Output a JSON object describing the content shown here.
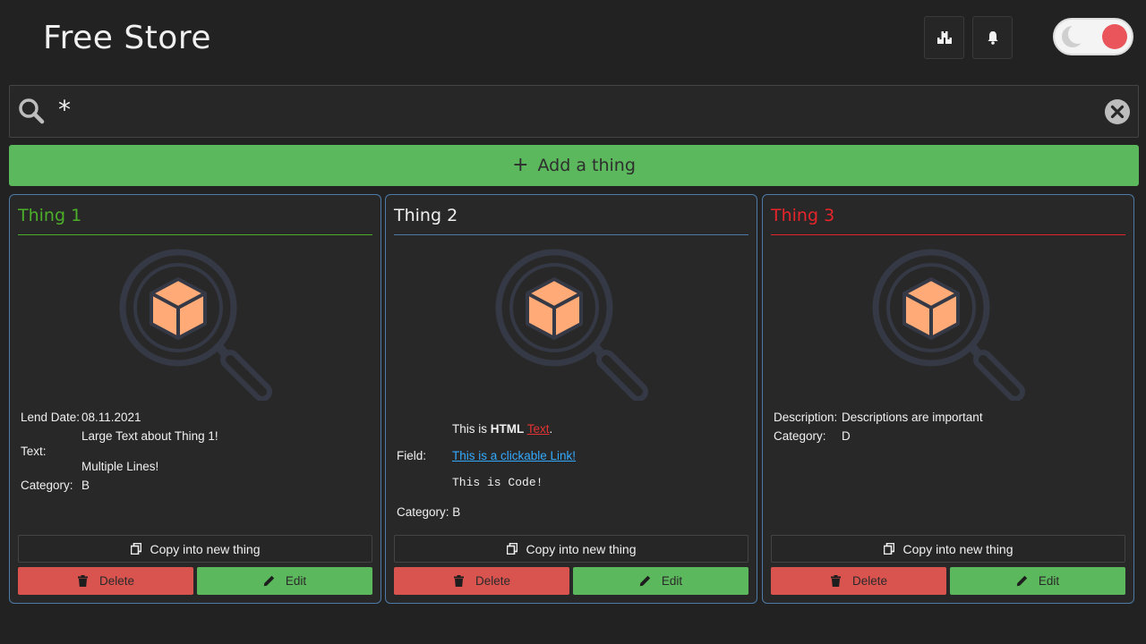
{
  "header": {
    "title": "Free Store",
    "buttons": [
      {
        "icon": "boxes-icon"
      },
      {
        "icon": "bell-icon"
      }
    ],
    "theme_toggle": {
      "icon": "moon-icon",
      "knob_color": "#e9555a"
    }
  },
  "search": {
    "value": "*",
    "placeholder": ""
  },
  "add_button": {
    "label": "Add a thing"
  },
  "colors": {
    "green": "#5cb85c",
    "red": "#d9534f",
    "border": "#4d7aa6",
    "thing1_title": "#4caf2a",
    "thing3_title": "#e5252a",
    "link": "#33aaff",
    "cube": "#ffaa77"
  },
  "cards": [
    {
      "title": "Thing 1",
      "lend_date_label": "Lend Date:",
      "lend_date_value": "08.11.2021",
      "text_label": "Text:",
      "text_line1": "Large Text about Thing 1!",
      "text_line2": "Multiple Lines!",
      "category_label": "Category:",
      "category_value": "B",
      "copy_label": "Copy into new thing",
      "delete_label": "Delete",
      "edit_label": "Edit"
    },
    {
      "title": "Thing 2",
      "html_prefix": "This is ",
      "html_bold": "HTML",
      "html_red": "Text",
      "html_suffix": ".",
      "field_label": "Field:",
      "link_text": "This is a clickable Link!",
      "code_text": "This is Code!",
      "category_label": "Category:",
      "category_value": "B",
      "copy_label": "Copy into new thing",
      "delete_label": "Delete",
      "edit_label": "Edit"
    },
    {
      "title": "Thing 3",
      "description_label": "Description:",
      "description_value": "Descriptions are important",
      "category_label": "Category:",
      "category_value": "D",
      "copy_label": "Copy into new thing",
      "delete_label": "Delete",
      "edit_label": "Edit"
    }
  ]
}
